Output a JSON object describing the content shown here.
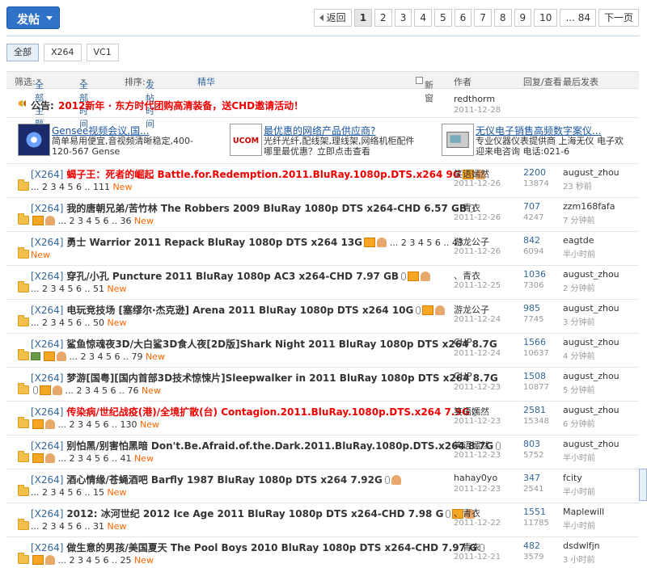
{
  "toolbar": {
    "post_label": "发帖"
  },
  "pager": {
    "prev_label": "返回",
    "pages": [
      "1",
      "2",
      "3",
      "4",
      "5",
      "6",
      "7",
      "8",
      "9",
      "10"
    ],
    "last_label": "... 84",
    "next_label": "下一页"
  },
  "tabs": [
    "全部",
    "X264",
    "VC1"
  ],
  "header": {
    "filter_label": "筛选:",
    "all_topics": "全部主题",
    "all_time": "全部时间",
    "sort_label": "排序:",
    "sort_value": "发帖时间",
    "digest": "精华",
    "new_window": "新窗",
    "author": "作者",
    "replies_views": "回复/查看",
    "last_post": "最后发表"
  },
  "announcement": {
    "label": "公告:",
    "text": "2012新年 · 东方时代团购高清装备，送CHD邀请活动！",
    "author": "redthorm",
    "date": "2011-12-28"
  },
  "ads": [
    {
      "title": "Gensee视频会议,国...",
      "desc": "简单易用便宜,音视频清晰稳定,400-120-567 Gense"
    },
    {
      "title": "最优惠的网络产品供应商?",
      "desc": "光纤光纤,配线架,理线架,网络机柜配件 哪里最优惠？立即点击查看",
      "logo": "UCOM"
    },
    {
      "title": "无仪电子销售高频数字案仪...",
      "desc": "专业仪器仪表提供商 上海无仪 电子欢迎来电咨询 电话:021-6"
    }
  ],
  "threads": [
    {
      "cat": "[X264]",
      "title": "蝎子王：死者的崛起 Battle.for.Redemption.2011.BluRay.1080p.DTS.x264 9G",
      "red": true,
      "pages": "... 2 3 4 5 6 .. 111",
      "new": "New",
      "author": "笑语嫣然",
      "date": "2011-12-26",
      "replies": "2200",
      "views": "13874",
      "last": "august_zhou",
      "last_time": "23 秒前"
    },
    {
      "cat": "[X264]",
      "title": "我的唐朝兄弟/苦竹林 The Robbers 2009 BluRay 1080p DTS x264-CHD 6.57 GB",
      "red": false,
      "pages": "... 2 3 4 5 6 .. 36",
      "new": "New",
      "author": "、青衣",
      "date": "2011-12-26",
      "replies": "707",
      "views": "4247",
      "last": "zzm168fafa",
      "last_time": "7 分钟前"
    },
    {
      "cat": "[X264]",
      "title": "勇士 Warrior 2011 Repack BluRay 1080p DTS x264 13G",
      "red": false,
      "pages": "... 2 3 4 5 6 .. 43",
      "new": "New",
      "author": "游龙公子",
      "date": "2011-12-26",
      "replies": "842",
      "views": "6094",
      "last": "eagtde",
      "last_time": "半小时前"
    },
    {
      "cat": "[X264]",
      "title": "穿孔/小孔 Puncture 2011 BluRay 1080p AC3 x264-CHD 7.97 GB",
      "red": false,
      "pages": "... 2 3 4 5 6 .. 51",
      "new": "New",
      "author": "、青衣",
      "date": "2011-12-25",
      "replies": "1036",
      "views": "7306",
      "last": "august_zhou",
      "last_time": "2 分钟前"
    },
    {
      "cat": "[X264]",
      "title": "电玩竞技场 [塞缪尔·杰克逊] Arena 2011 BluRay 1080p DTS x264 10G",
      "red": false,
      "pages": "... 2 3 4 5 6 .. 50",
      "new": "New",
      "author": "游龙公子",
      "date": "2011-12-24",
      "replies": "985",
      "views": "7745",
      "last": "august_zhou",
      "last_time": "3 分钟前"
    },
    {
      "cat": "[X264]",
      "title": "鲨鱼惊魂夜3D/大白鲨3D食人夜[2D版]Shark Night 2011 BluRay 1080p DTS x264 8.7G",
      "red": false,
      "pages": "... 2 3 4 5 6 .. 79",
      "new": "New",
      "author": "CHP",
      "date": "2011-12-24",
      "replies": "1566",
      "views": "10637",
      "last": "august_zhou",
      "last_time": "4 分钟前"
    },
    {
      "cat": "[X264]",
      "title": "梦游[国粤][国内首部3D技术惊悚片]Sleepwalker in 2011 BluRay 1080p DTS x264 8.7G",
      "red": false,
      "pages": "... 2 3 4 5 6 .. 76",
      "new": "New",
      "author": "CHP",
      "date": "2011-12-23",
      "replies": "1508",
      "views": "10877",
      "last": "august_zhou",
      "last_time": "5 分钟前"
    },
    {
      "cat": "[X264]",
      "title": "传染病/世纪战疫(港)/全境扩散(台) Contagion.2011.BluRay.1080p.DTS.x264 7.9G",
      "red": true,
      "pages": "... 2 3 4 5 6 .. 130",
      "new": "New",
      "author": "笑语嫣然",
      "date": "2011-12-23",
      "replies": "2581",
      "views": "15348",
      "last": "august_zhou",
      "last_time": "6 分钟前"
    },
    {
      "cat": "[X264]",
      "title": "别怕黑/别害怕黑暗 Don't.Be.Afraid.of.the.Dark.2011.BluRay.1080p.DTS.x264 8.7G",
      "red": false,
      "pages": "... 2 3 4 5 6 .. 41",
      "new": "New",
      "author": "笑语嫣然",
      "date": "2011-12-23",
      "replies": "803",
      "views": "5752",
      "last": "august_zhou",
      "last_time": "半小时前"
    },
    {
      "cat": "[X264]",
      "title": "酒心情缘/苍蝇酒吧 Barfly 1987 BluRay 1080p DTS x264 7.92G",
      "red": false,
      "pages": "... 2 3 4 5 6 .. 15",
      "new": "New",
      "author": "hahay0yo",
      "date": "2011-12-23",
      "replies": "347",
      "views": "2541",
      "last": "fcity",
      "last_time": "半小时前"
    },
    {
      "cat": "[X264]",
      "title": "2012: 冰河世纪 2012 Ice Age 2011 BluRay 1080p DTS x264-CHD 7.98 G",
      "red": false,
      "pages": "... 2 3 4 5 6 .. 31",
      "new": "New",
      "author": "、青衣",
      "date": "2011-12-22",
      "replies": "1551",
      "views": "11785",
      "last": "Maplewill",
      "last_time": "半小时前"
    },
    {
      "cat": "[X264]",
      "title": "做生意的男孩/美国夏天 The Pool Boys 2010 BluRay 1080p DTS x264-CHD 7.97 G",
      "red": false,
      "pages": "... 2 3 4 5 6 .. 25",
      "new": "New",
      "author": "、青衣",
      "date": "2011-12-21",
      "replies": "482",
      "views": "3579",
      "last": "dsdwlfjn",
      "last_time": "3 小时前"
    }
  ]
}
